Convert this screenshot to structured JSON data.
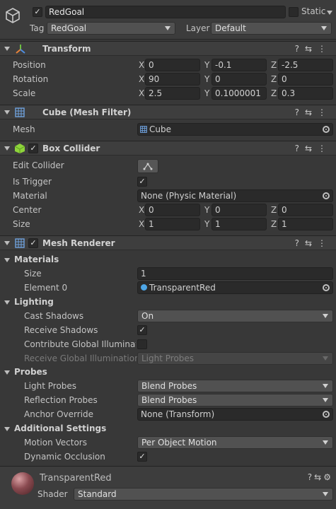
{
  "object": {
    "name": "RedGoal",
    "static_label": "Static",
    "tag_label": "Tag",
    "tag_value": "RedGoal",
    "layer_label": "Layer",
    "layer_value": "Default"
  },
  "transform": {
    "title": "Transform",
    "position_label": "Position",
    "rotation_label": "Rotation",
    "scale_label": "Scale",
    "position": {
      "x": "0",
      "y": "-0.1",
      "z": "-2.5"
    },
    "rotation": {
      "x": "90",
      "y": "0",
      "z": "0"
    },
    "scale": {
      "x": "2.5",
      "y": "0.1000001",
      "z": "0.3"
    }
  },
  "axes": {
    "x": "X",
    "y": "Y",
    "z": "Z"
  },
  "mesh_filter": {
    "title": "Cube (Mesh Filter)",
    "mesh_label": "Mesh",
    "mesh_value": "Cube"
  },
  "box_collider": {
    "title": "Box Collider",
    "edit_collider_label": "Edit Collider",
    "is_trigger_label": "Is Trigger",
    "material_label": "Material",
    "material_value": "None (Physic Material)",
    "center_label": "Center",
    "center": {
      "x": "0",
      "y": "0",
      "z": "0"
    },
    "size_label": "Size",
    "size": {
      "x": "1",
      "y": "1",
      "z": "1"
    }
  },
  "mesh_renderer": {
    "title": "Mesh Renderer",
    "materials_label": "Materials",
    "size_label": "Size",
    "size_value": "1",
    "element0_label": "Element 0",
    "element0_value": "TransparentRed",
    "lighting_label": "Lighting",
    "cast_shadows_label": "Cast Shadows",
    "cast_shadows_value": "On",
    "receive_shadows_label": "Receive Shadows",
    "contribute_gi_label": "Contribute Global Illumination",
    "receive_gi_label": "Receive Global Illumination",
    "receive_gi_value": "Light Probes",
    "probes_label": "Probes",
    "light_probes_label": "Light Probes",
    "light_probes_value": "Blend Probes",
    "reflection_probes_label": "Reflection Probes",
    "reflection_probes_value": "Blend Probes",
    "anchor_override_label": "Anchor Override",
    "anchor_override_value": "None (Transform)",
    "additional_label": "Additional Settings",
    "motion_vectors_label": "Motion Vectors",
    "motion_vectors_value": "Per Object Motion",
    "dynamic_occlusion_label": "Dynamic Occlusion"
  },
  "material": {
    "name": "TransparentRed",
    "shader_label": "Shader",
    "shader_value": "Standard"
  },
  "icons": {
    "check": "✓",
    "help": "?",
    "presets": "⇆",
    "menu": "⋮",
    "settings": "⚙"
  }
}
